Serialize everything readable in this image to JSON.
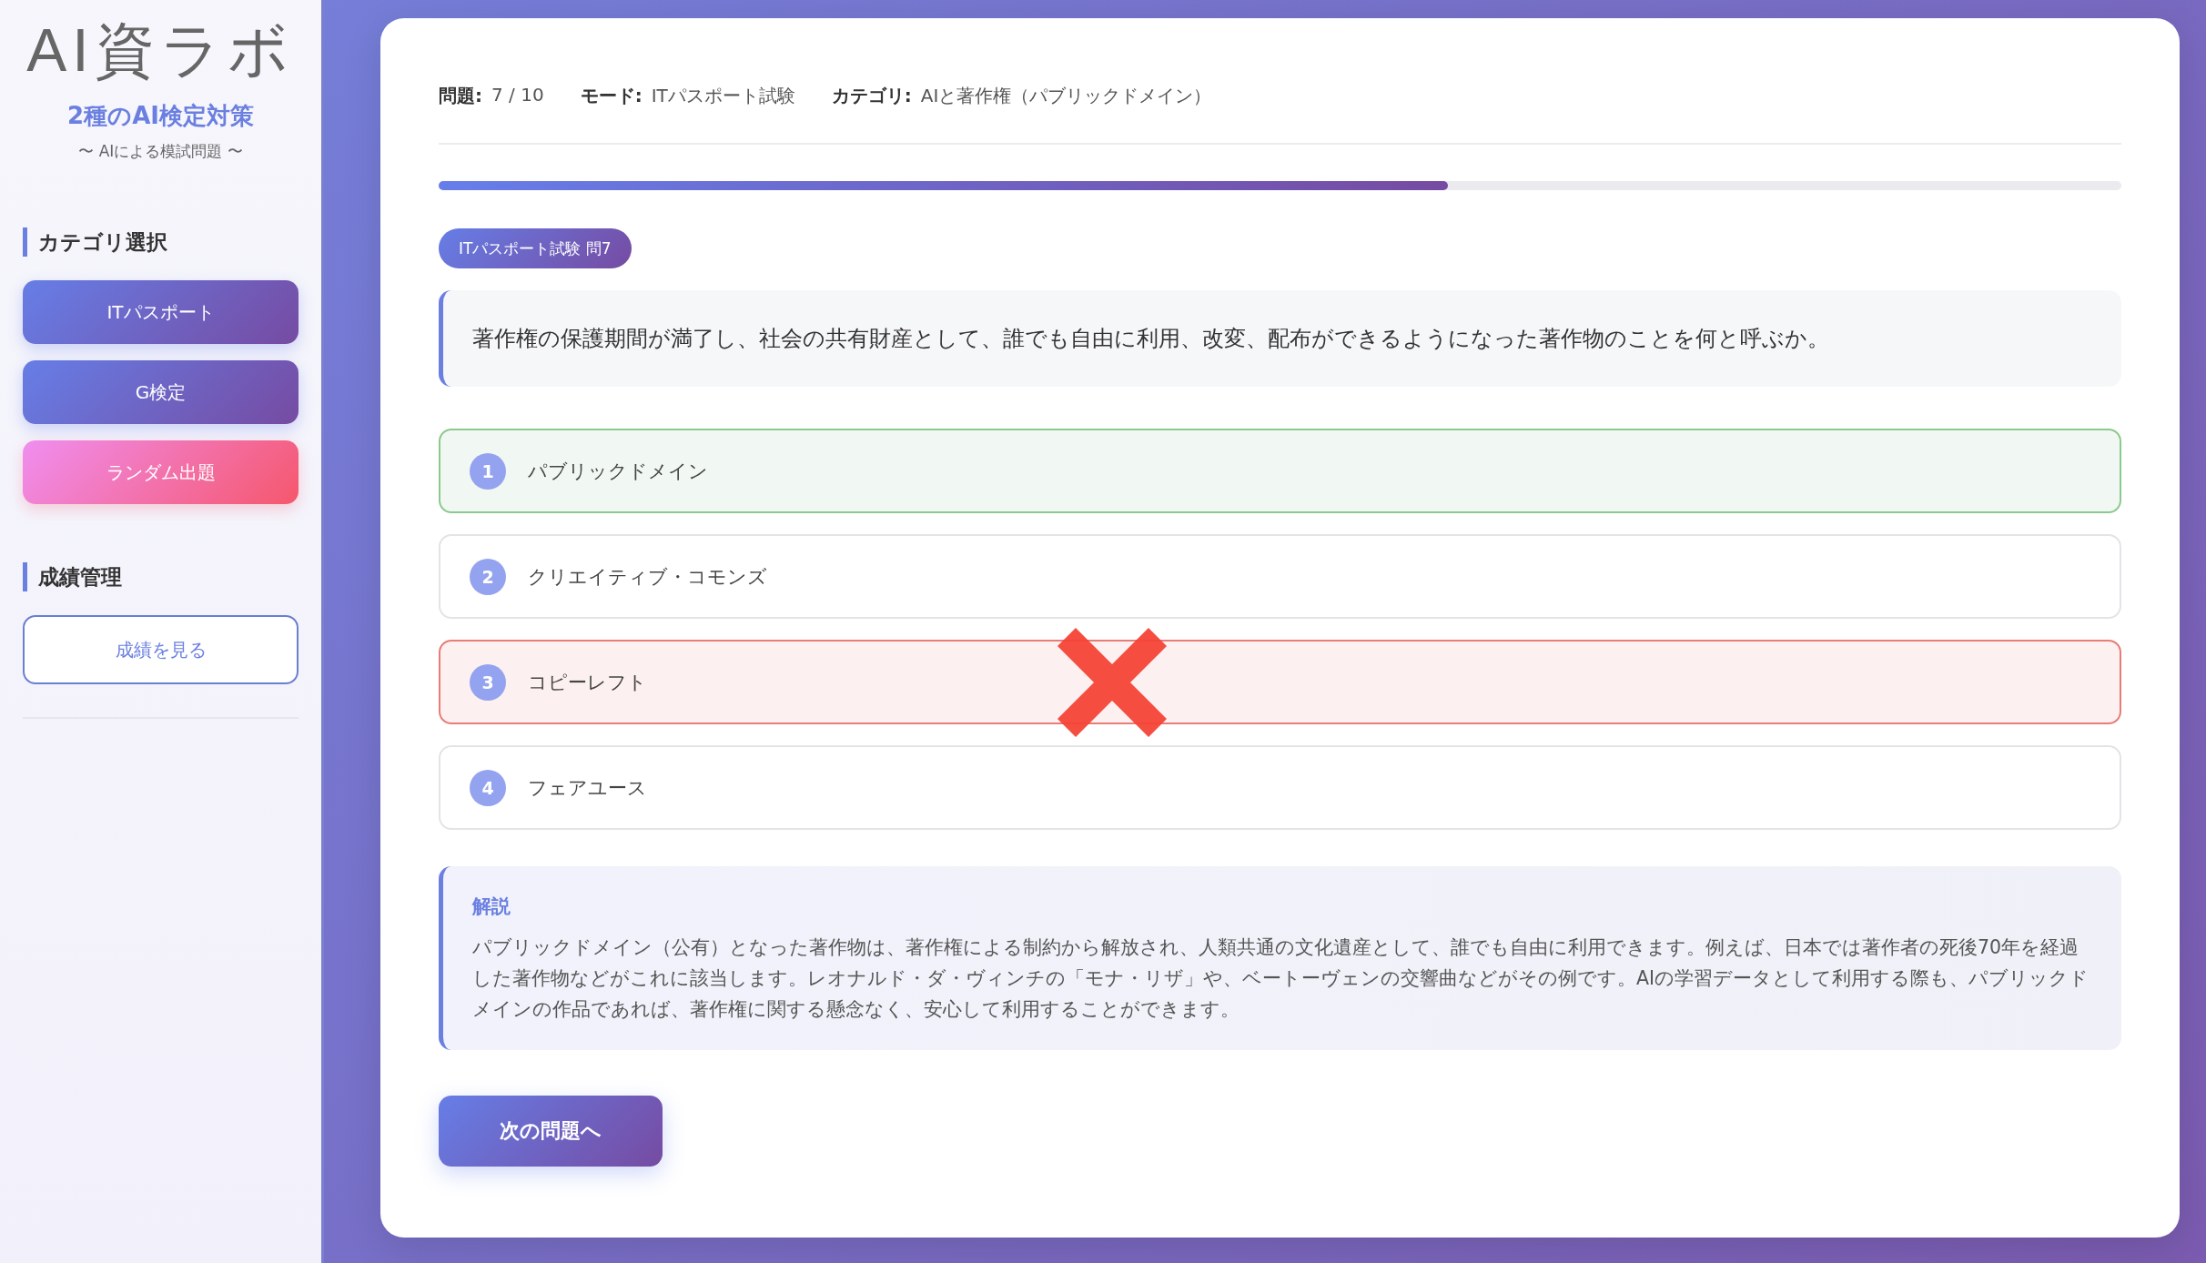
{
  "sidebar": {
    "logo": "AI資ラボ",
    "title": "2種のAI検定対策",
    "subtitle": "〜 AIによる模試問題 〜",
    "sections": [
      {
        "heading": "カテゴリ選択",
        "buttons": [
          {
            "label": "ITパスポート",
            "kind": "primary"
          },
          {
            "label": "G検定",
            "kind": "primary"
          },
          {
            "label": "ランダム出題",
            "kind": "random"
          }
        ]
      },
      {
        "heading": "成績管理",
        "buttons": [
          {
            "label": "成績を見る",
            "kind": "outline"
          }
        ]
      }
    ]
  },
  "quiz": {
    "meta": [
      {
        "label": "問題:",
        "value": "7 / 10"
      },
      {
        "label": "モード:",
        "value": "ITパスポート試験"
      },
      {
        "label": "カテゴリ:",
        "value": "AIと著作権（パブリックドメイン）"
      }
    ],
    "progress": {
      "level": 0.6
    },
    "badge": "ITパスポート試験 問7",
    "question": "著作権の保護期間が満了し、社会の共有財産として、誰でも自由に利用、改変、配布ができるようになった著作物のことを何と呼ぶか。",
    "options": [
      {
        "number": "1",
        "text": "パブリックドメイン",
        "kind": "correct"
      },
      {
        "number": "2",
        "text": "クリエイティブ・コモンズ",
        "kind": "plain"
      },
      {
        "number": "3",
        "text": "コピーレフト",
        "kind": "wrong"
      },
      {
        "number": "4",
        "text": "フェアユース",
        "kind": "plain"
      }
    ],
    "explanation": {
      "title": "解説",
      "text": "パブリックドメイン（公有）となった著作物は、著作権による制約から解放され、人類共通の文化遺産として、誰でも自由に利用できます。例えば、日本では著作者の死後70年を経過した著作物などがこれに該当します。レオナルド・ダ・ヴィンチの「モナ・リザ」や、ベートーヴェンの交響曲などがその例です。AIの学習データとして利用する際も、パブリックドメインの作品であれば、著作権に関する懸念なく、安心して利用することができます。"
    },
    "next_button": "次の問題へ"
  }
}
